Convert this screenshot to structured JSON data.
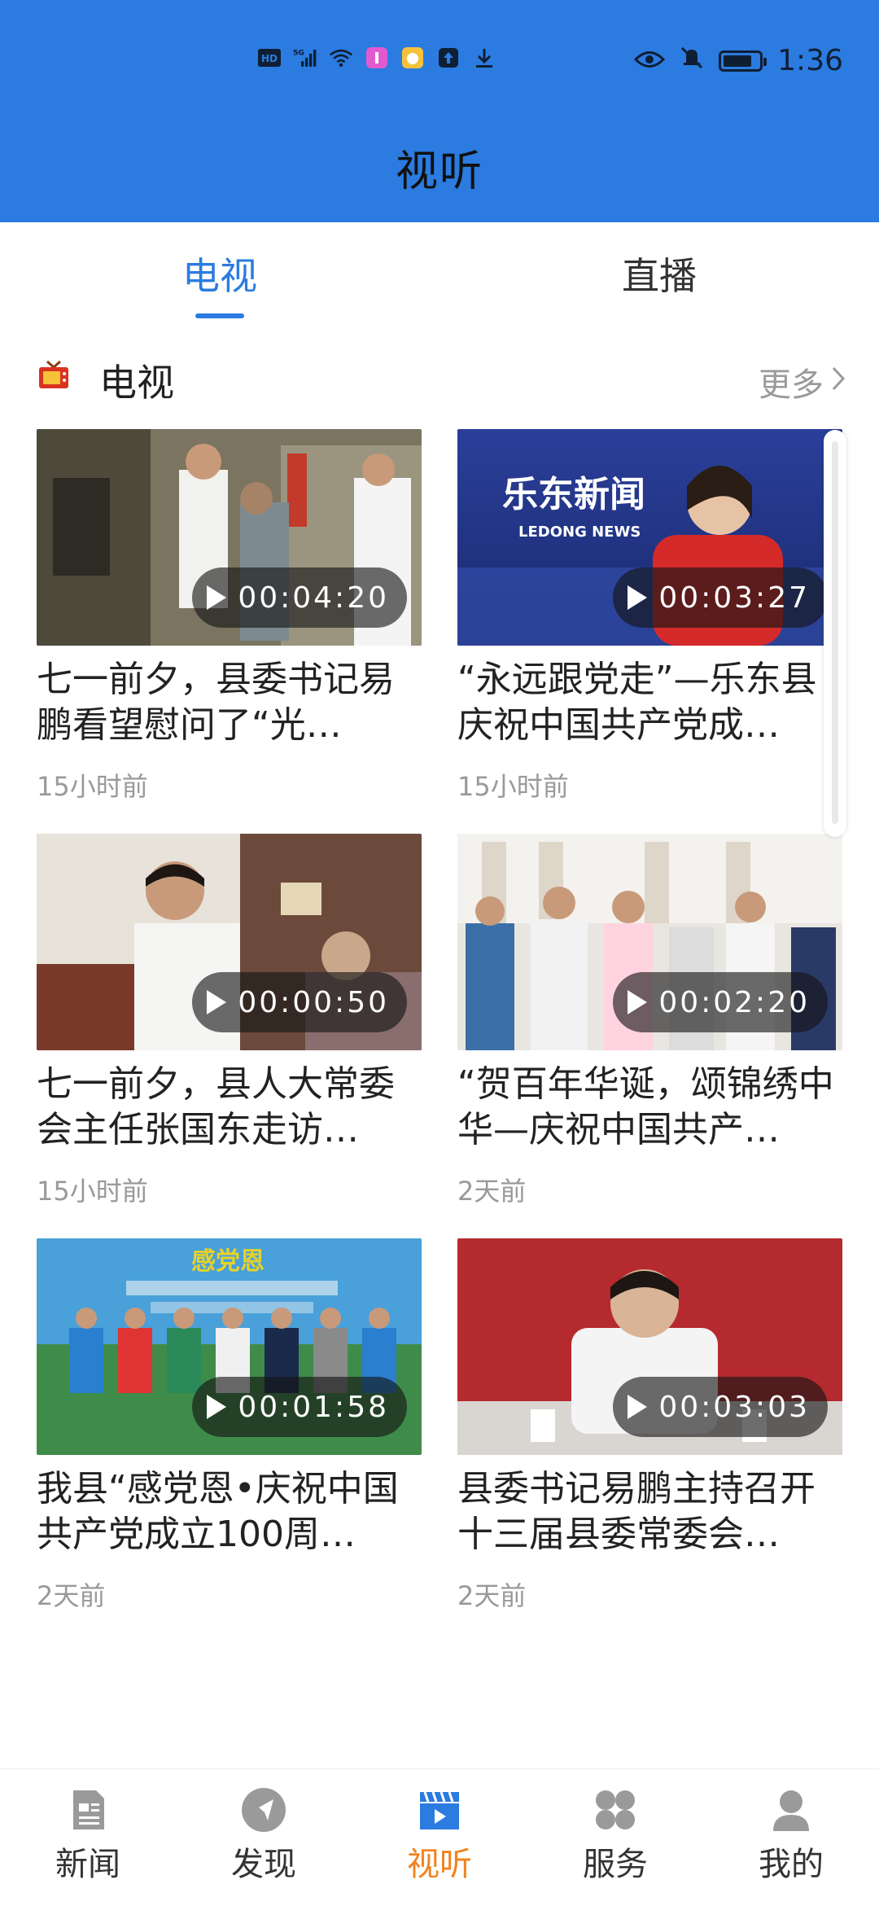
{
  "status_bar": {
    "time": "1:36",
    "icons": [
      "hd-icon",
      "5g-signal-icon",
      "wifi-icon",
      "app-notification-icon",
      "app-notification-icon",
      "upload-icon",
      "download-icon",
      "eye-icon",
      "mute-bell-icon",
      "battery-icon"
    ]
  },
  "header": {
    "title": "视听"
  },
  "tabs": [
    {
      "label": "电视",
      "active": true
    },
    {
      "label": "直播",
      "active": false
    }
  ],
  "section": {
    "title": "电视",
    "more_label": "更多",
    "icon": "tv-icon"
  },
  "videos": [
    {
      "title": "七一前夕，县委书记易鹏看望慰问了“光…",
      "duration": "00:04:20",
      "time": "15小时前"
    },
    {
      "title": "“永远跟党走”—乐东县庆祝中国共产党成…",
      "duration": "00:03:27",
      "time": "15小时前",
      "thumb_text": "乐东新闻",
      "thumb_subtext": "LEDONG NEWS"
    },
    {
      "title": "七一前夕，县人大常委会主任张国东走访…",
      "duration": "00:00:50",
      "time": "15小时前"
    },
    {
      "title": "“贺百年华诞，颂锦绣中华—庆祝中国共产…",
      "duration": "00:02:20",
      "time": "2天前"
    },
    {
      "title": "我县“感党恩•庆祝中国共产党成立100周…",
      "duration": "00:01:58",
      "time": "2天前",
      "thumb_text": "感党恩"
    },
    {
      "title": "县委书记易鹏主持召开十三届县委常委会…",
      "duration": "00:03:03",
      "time": "2天前"
    }
  ],
  "bottom_nav": [
    {
      "label": "新闻",
      "icon": "news-icon",
      "active": false
    },
    {
      "label": "发现",
      "icon": "discover-icon",
      "active": false
    },
    {
      "label": "视听",
      "icon": "video-icon",
      "active": true
    },
    {
      "label": "服务",
      "icon": "services-icon",
      "active": false
    },
    {
      "label": "我的",
      "icon": "profile-icon",
      "active": false
    }
  ],
  "colors": {
    "brand_blue": "#2B7BE0",
    "active_orange": "#F2821E",
    "muted_gray": "#999999"
  }
}
